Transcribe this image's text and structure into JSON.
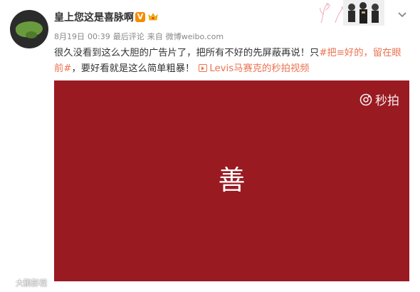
{
  "post": {
    "username": "皇上您这是喜脉啊",
    "verified_badge": "V",
    "meta": {
      "date": "8月19日",
      "time": "00:39",
      "edited": "最后评论",
      "source_prefix": "来自",
      "source": "微博weibo.com"
    },
    "text": {
      "body": "很久没看到这么大胆的广告片了，把所有不好的先屏蔽再说！只",
      "hashtag": "#把≡好的，留在眼前#",
      "tail": "，要好看就是这么简单粗暴！",
      "video_link_label": "Levis马赛克的秒拍视频"
    }
  },
  "video": {
    "center_char": "善",
    "brand": "秒拍",
    "background_color": "#9a1a22"
  },
  "watermark": {
    "text": "大鹏影视"
  },
  "icons": {
    "avatar": "frog-avatar",
    "verified": "verified-v-icon",
    "member": "member-crown-icon",
    "chevron": "chevron-down-icon",
    "video": "video-play-icon",
    "miaopai": "miaopai-logo-icon",
    "watermark": "watermark-logo-icon"
  },
  "colors": {
    "accent": "#eb7350",
    "verified": "#f78a00",
    "video_bg": "#9a1a22",
    "meta_text": "#888888"
  }
}
